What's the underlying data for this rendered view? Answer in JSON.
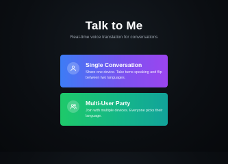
{
  "header": {
    "title": "Talk to Me",
    "subtitle": "Real-time voice translation for conversations"
  },
  "options": [
    {
      "title": "Single Conversation",
      "description": "Share one device. Take turns speaking and flip between two languages.",
      "icon": "user-icon",
      "gradient": [
        "#3d7cf5",
        "#9b45ef"
      ]
    },
    {
      "title": "Multi-User Party",
      "description": "Join with multiple devices. Everyone picks their language.",
      "icon": "users-icon",
      "gradient": [
        "#1ec96a",
        "#12a39a"
      ]
    }
  ]
}
